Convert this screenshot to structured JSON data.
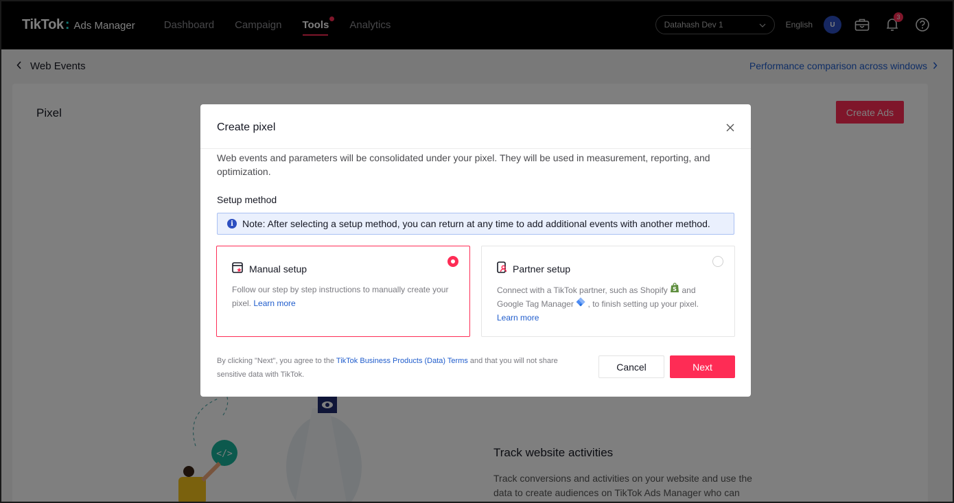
{
  "nav": {
    "brand": "TikTok",
    "product": "Ads Manager",
    "items": [
      {
        "label": "Dashboard",
        "active": false
      },
      {
        "label": "Campaign",
        "active": false
      },
      {
        "label": "Tools",
        "active": true
      },
      {
        "label": "Analytics",
        "active": false
      }
    ],
    "account": "Datahash Dev 1",
    "language": "English",
    "avatar_initial": "U",
    "notification_count": "3"
  },
  "header": {
    "back_label": "Web Events",
    "perf_link": "Performance comparison across windows"
  },
  "page": {
    "title": "Pixel",
    "create_ads": "Create Ads",
    "track_title": "Track website activities",
    "track_desc": "Track conversions and activities on your website and use the data to create audiences on TikTok Ads Manager who can"
  },
  "modal": {
    "title": "Create pixel",
    "description": "Web events and parameters will be consolidated under your pixel. They will be used in measurement, reporting, and optimization.",
    "setup_label": "Setup method",
    "note": "Note: After selecting a setup method, you can return at any time to add additional events with another method.",
    "options": [
      {
        "title": "Manual setup",
        "desc": "Follow our step by step instructions to manually create your pixel.",
        "link": "Learn more",
        "selected": true
      },
      {
        "title": "Partner setup",
        "desc_a": "Connect with a TikTok partner, such as Shopify",
        "desc_b": "and Google Tag Manager",
        "desc_c": ", to finish setting up your pixel.",
        "link": "Learn more",
        "selected": false
      }
    ],
    "footer_prefix": "By clicking \"Next\", you agree to the ",
    "footer_link": "TikTok Business Products (Data) Terms",
    "footer_suffix": " and that you will not share sensitive data with TikTok.",
    "cancel": "Cancel",
    "next": "Next"
  },
  "colors": {
    "accent": "#fe2c55",
    "link": "#1f5ccc",
    "note_bg": "#eaf0fd"
  }
}
